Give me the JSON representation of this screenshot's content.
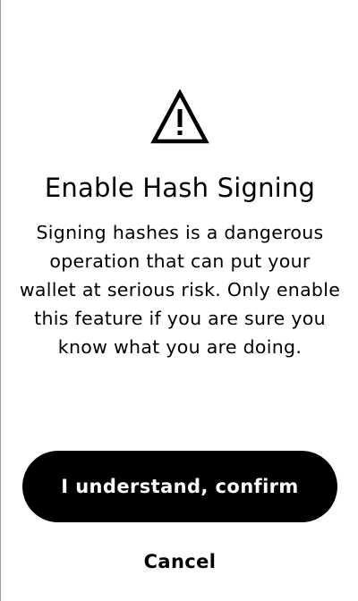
{
  "dialog": {
    "icon": "warning-triangle-icon",
    "title": "Enable Hash Signing",
    "message": "Signing hashes is a dangerous operation that can put your wallet at serious risk. Only enable this feature if you are sure you know what you are doing.",
    "confirm_label": "I understand, confirm",
    "cancel_label": "Cancel"
  },
  "colors": {
    "background": "#ffffff",
    "primary_button": "#000000",
    "primary_button_text": "#ffffff",
    "text": "#000000"
  }
}
